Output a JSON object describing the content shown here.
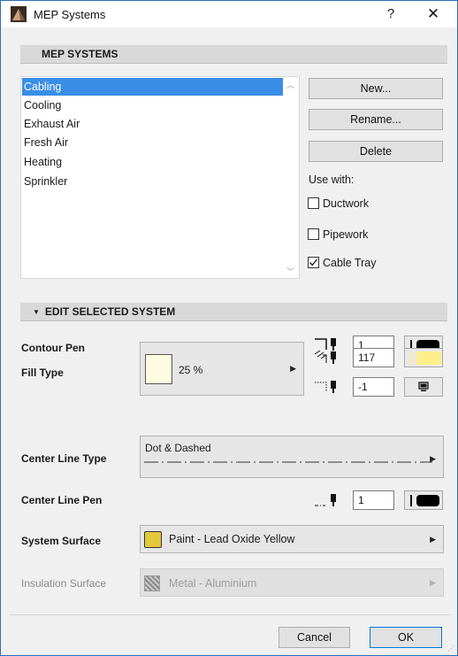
{
  "window": {
    "title": "MEP Systems",
    "help_label": "?",
    "close_label": "✕"
  },
  "systems_section": {
    "header": "MEP SYSTEMS",
    "items": [
      {
        "label": "Cabling",
        "selected": true
      },
      {
        "label": "Cooling",
        "selected": false
      },
      {
        "label": "Exhaust Air",
        "selected": false
      },
      {
        "label": "Fresh Air",
        "selected": false
      },
      {
        "label": "Heating",
        "selected": false
      },
      {
        "label": "Sprinkler",
        "selected": false
      }
    ],
    "buttons": {
      "new": "New...",
      "rename": "Rename...",
      "delete": "Delete"
    },
    "use_with": {
      "label": "Use with:",
      "options": [
        {
          "label": "Ductwork",
          "checked": false
        },
        {
          "label": "Pipework",
          "checked": false
        },
        {
          "label": "Cable Tray",
          "checked": true
        }
      ]
    }
  },
  "edit_section": {
    "header": "EDIT SELECTED SYSTEM",
    "contour_pen": {
      "label": "Contour Pen",
      "value": "1"
    },
    "fill_type": {
      "label": "Fill Type",
      "fill_value": "25 %",
      "foreground_pen": "117",
      "background_pen": "-1"
    },
    "center_line_type": {
      "label": "Center Line Type",
      "value": "Dot & Dashed"
    },
    "center_line_pen": {
      "label": "Center Line Pen",
      "value": "1"
    },
    "system_surface": {
      "label": "System Surface",
      "value": "Paint - Lead Oxide Yellow",
      "swatch_color": "#e3c93c"
    },
    "insulation_surface": {
      "label": "Insulation Surface",
      "value": "Metal - Aluminium"
    }
  },
  "footer": {
    "cancel": "Cancel",
    "ok": "OK"
  },
  "colors": {
    "selection": "#3a8ee6",
    "fill_swatch": "#fffbe0",
    "pen_117": "#ffef8a"
  }
}
